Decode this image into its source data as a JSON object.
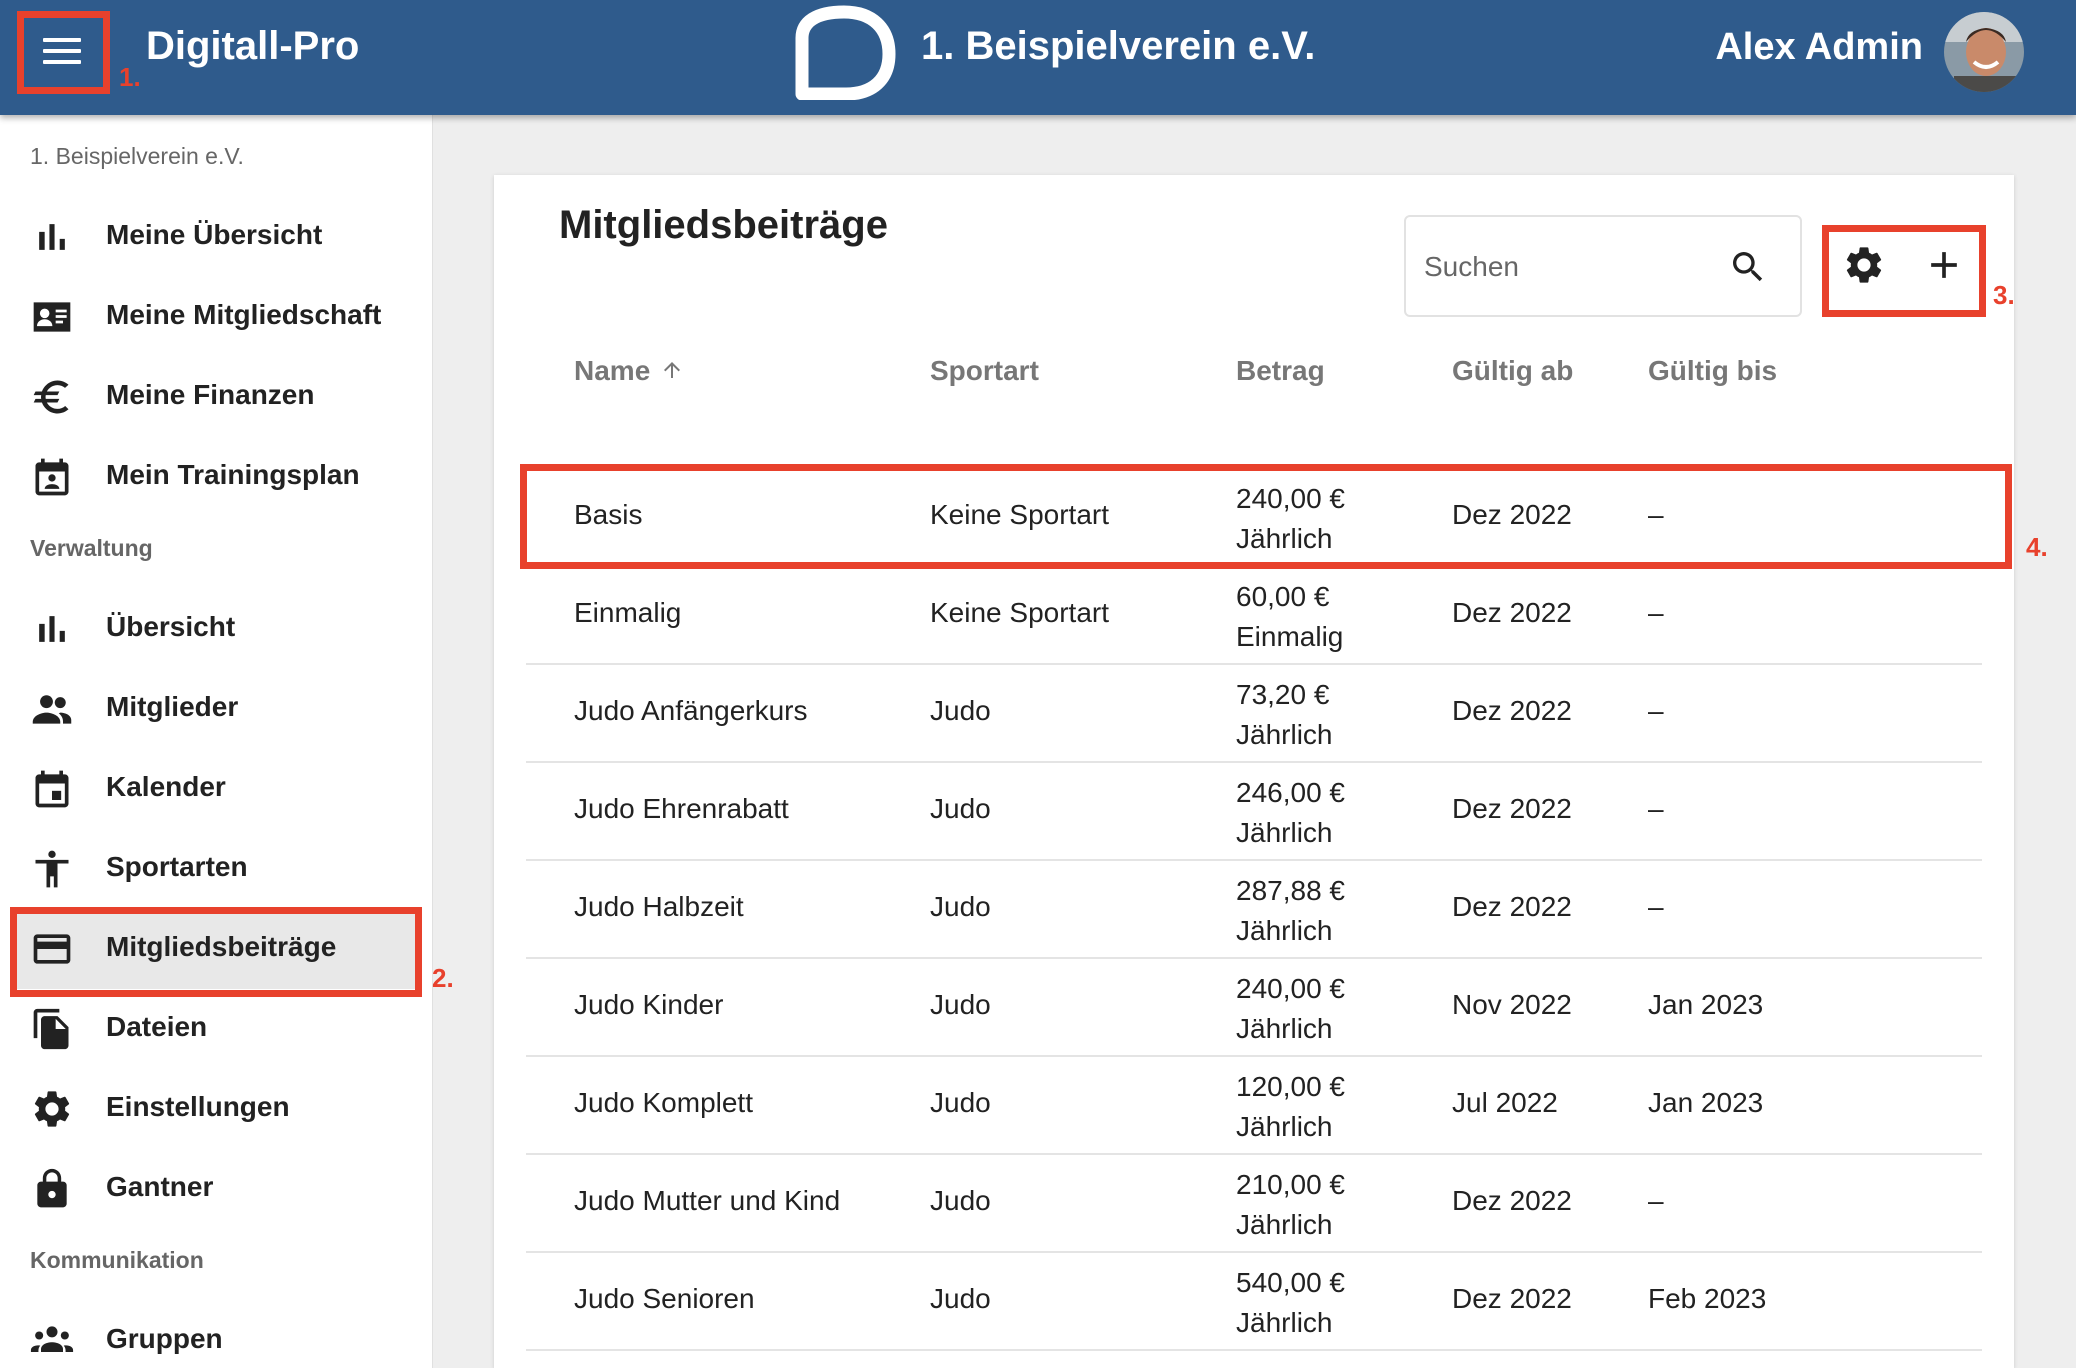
{
  "header": {
    "app_title": "Digitall-Pro",
    "club_name": "1. Beispielverein e.V.",
    "user_name": "Alex Admin",
    "bar_color": "#2f5b8c"
  },
  "sidebar": {
    "club_label": "1. Beispielverein e.V.",
    "section_admin": "Verwaltung",
    "section_comm": "Kommunikation",
    "items": [
      {
        "label": "Meine Übersicht",
        "icon": "bar-chart-icon"
      },
      {
        "label": "Meine Mitgliedschaft",
        "icon": "id-card-icon"
      },
      {
        "label": "Meine Finanzen",
        "icon": "euro-icon"
      },
      {
        "label": "Mein Trainingsplan",
        "icon": "calendar-person-icon"
      },
      {
        "label": "Übersicht",
        "icon": "bar-chart-icon"
      },
      {
        "label": "Mitglieder",
        "icon": "people-icon"
      },
      {
        "label": "Kalender",
        "icon": "calendar-icon"
      },
      {
        "label": "Sportarten",
        "icon": "sport-figure-icon"
      },
      {
        "label": "Mitgliedsbeiträge",
        "icon": "credit-card-icon",
        "active": true
      },
      {
        "label": "Dateien",
        "icon": "files-icon"
      },
      {
        "label": "Einstellungen",
        "icon": "gear-icon"
      },
      {
        "label": "Gantner",
        "icon": "lock-icon"
      },
      {
        "label": "Gruppen",
        "icon": "groups-icon"
      }
    ]
  },
  "main": {
    "title": "Mitgliedsbeiträge",
    "search_placeholder": "Suchen",
    "columns": {
      "name": "Name",
      "sport": "Sportart",
      "amount": "Betrag",
      "valid_from": "Gültig ab",
      "valid_to": "Gültig bis"
    },
    "sort": {
      "column": "name",
      "direction": "ascending"
    },
    "rows": [
      {
        "name": "Basis",
        "sport": "Keine Sportart",
        "amount": "240,00 €",
        "interval": "Jährlich",
        "from": "Dez 2022",
        "to": "–"
      },
      {
        "name": "Einmalig",
        "sport": "Keine Sportart",
        "amount": "60,00 €",
        "interval": "Einmalig",
        "from": "Dez 2022",
        "to": "–"
      },
      {
        "name": "Judo Anfängerkurs",
        "sport": "Judo",
        "amount": "73,20 €",
        "interval": "Jährlich",
        "from": "Dez 2022",
        "to": "–"
      },
      {
        "name": "Judo Ehrenrabatt",
        "sport": "Judo",
        "amount": "246,00 €",
        "interval": "Jährlich",
        "from": "Dez 2022",
        "to": "–"
      },
      {
        "name": "Judo Halbzeit",
        "sport": "Judo",
        "amount": "287,88 €",
        "interval": "Jährlich",
        "from": "Dez 2022",
        "to": "–"
      },
      {
        "name": "Judo Kinder",
        "sport": "Judo",
        "amount": "240,00 €",
        "interval": "Jährlich",
        "from": "Nov 2022",
        "to": "Jan 2023"
      },
      {
        "name": "Judo Komplett",
        "sport": "Judo",
        "amount": "120,00 €",
        "interval": "Jährlich",
        "from": "Jul 2022",
        "to": "Jan 2023"
      },
      {
        "name": "Judo Mutter und Kind",
        "sport": "Judo",
        "amount": "210,00 €",
        "interval": "Jährlich",
        "from": "Dez 2022",
        "to": "–"
      },
      {
        "name": "Judo Senioren",
        "sport": "Judo",
        "amount": "540,00 €",
        "interval": "Jährlich",
        "from": "Dez 2022",
        "to": "Feb 2023"
      }
    ]
  },
  "annotations": {
    "menu": "1.",
    "sidebar_item": "2.",
    "toolbar": "3.",
    "row": "4.",
    "color": "#e8412c"
  }
}
